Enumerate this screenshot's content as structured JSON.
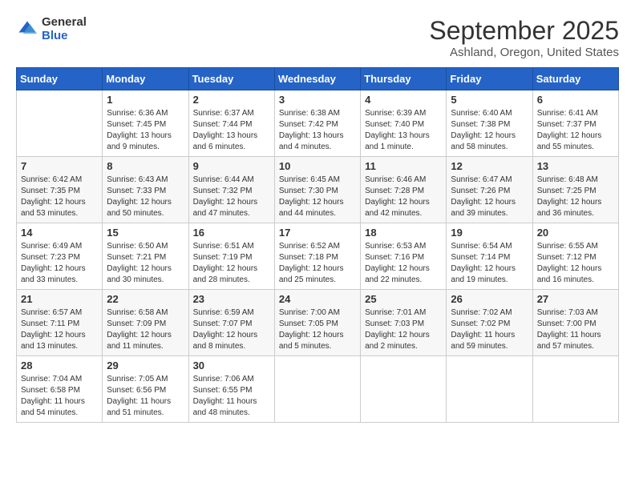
{
  "header": {
    "logo_general": "General",
    "logo_blue": "Blue",
    "month_title": "September 2025",
    "location": "Ashland, Oregon, United States"
  },
  "days_of_week": [
    "Sunday",
    "Monday",
    "Tuesday",
    "Wednesday",
    "Thursday",
    "Friday",
    "Saturday"
  ],
  "weeks": [
    [
      {
        "day": "",
        "info": ""
      },
      {
        "day": "1",
        "info": "Sunrise: 6:36 AM\nSunset: 7:45 PM\nDaylight: 13 hours\nand 9 minutes."
      },
      {
        "day": "2",
        "info": "Sunrise: 6:37 AM\nSunset: 7:44 PM\nDaylight: 13 hours\nand 6 minutes."
      },
      {
        "day": "3",
        "info": "Sunrise: 6:38 AM\nSunset: 7:42 PM\nDaylight: 13 hours\nand 4 minutes."
      },
      {
        "day": "4",
        "info": "Sunrise: 6:39 AM\nSunset: 7:40 PM\nDaylight: 13 hours\nand 1 minute."
      },
      {
        "day": "5",
        "info": "Sunrise: 6:40 AM\nSunset: 7:38 PM\nDaylight: 12 hours\nand 58 minutes."
      },
      {
        "day": "6",
        "info": "Sunrise: 6:41 AM\nSunset: 7:37 PM\nDaylight: 12 hours\nand 55 minutes."
      }
    ],
    [
      {
        "day": "7",
        "info": "Sunrise: 6:42 AM\nSunset: 7:35 PM\nDaylight: 12 hours\nand 53 minutes."
      },
      {
        "day": "8",
        "info": "Sunrise: 6:43 AM\nSunset: 7:33 PM\nDaylight: 12 hours\nand 50 minutes."
      },
      {
        "day": "9",
        "info": "Sunrise: 6:44 AM\nSunset: 7:32 PM\nDaylight: 12 hours\nand 47 minutes."
      },
      {
        "day": "10",
        "info": "Sunrise: 6:45 AM\nSunset: 7:30 PM\nDaylight: 12 hours\nand 44 minutes."
      },
      {
        "day": "11",
        "info": "Sunrise: 6:46 AM\nSunset: 7:28 PM\nDaylight: 12 hours\nand 42 minutes."
      },
      {
        "day": "12",
        "info": "Sunrise: 6:47 AM\nSunset: 7:26 PM\nDaylight: 12 hours\nand 39 minutes."
      },
      {
        "day": "13",
        "info": "Sunrise: 6:48 AM\nSunset: 7:25 PM\nDaylight: 12 hours\nand 36 minutes."
      }
    ],
    [
      {
        "day": "14",
        "info": "Sunrise: 6:49 AM\nSunset: 7:23 PM\nDaylight: 12 hours\nand 33 minutes."
      },
      {
        "day": "15",
        "info": "Sunrise: 6:50 AM\nSunset: 7:21 PM\nDaylight: 12 hours\nand 30 minutes."
      },
      {
        "day": "16",
        "info": "Sunrise: 6:51 AM\nSunset: 7:19 PM\nDaylight: 12 hours\nand 28 minutes."
      },
      {
        "day": "17",
        "info": "Sunrise: 6:52 AM\nSunset: 7:18 PM\nDaylight: 12 hours\nand 25 minutes."
      },
      {
        "day": "18",
        "info": "Sunrise: 6:53 AM\nSunset: 7:16 PM\nDaylight: 12 hours\nand 22 minutes."
      },
      {
        "day": "19",
        "info": "Sunrise: 6:54 AM\nSunset: 7:14 PM\nDaylight: 12 hours\nand 19 minutes."
      },
      {
        "day": "20",
        "info": "Sunrise: 6:55 AM\nSunset: 7:12 PM\nDaylight: 12 hours\nand 16 minutes."
      }
    ],
    [
      {
        "day": "21",
        "info": "Sunrise: 6:57 AM\nSunset: 7:11 PM\nDaylight: 12 hours\nand 13 minutes."
      },
      {
        "day": "22",
        "info": "Sunrise: 6:58 AM\nSunset: 7:09 PM\nDaylight: 12 hours\nand 11 minutes."
      },
      {
        "day": "23",
        "info": "Sunrise: 6:59 AM\nSunset: 7:07 PM\nDaylight: 12 hours\nand 8 minutes."
      },
      {
        "day": "24",
        "info": "Sunrise: 7:00 AM\nSunset: 7:05 PM\nDaylight: 12 hours\nand 5 minutes."
      },
      {
        "day": "25",
        "info": "Sunrise: 7:01 AM\nSunset: 7:03 PM\nDaylight: 12 hours\nand 2 minutes."
      },
      {
        "day": "26",
        "info": "Sunrise: 7:02 AM\nSunset: 7:02 PM\nDaylight: 11 hours\nand 59 minutes."
      },
      {
        "day": "27",
        "info": "Sunrise: 7:03 AM\nSunset: 7:00 PM\nDaylight: 11 hours\nand 57 minutes."
      }
    ],
    [
      {
        "day": "28",
        "info": "Sunrise: 7:04 AM\nSunset: 6:58 PM\nDaylight: 11 hours\nand 54 minutes."
      },
      {
        "day": "29",
        "info": "Sunrise: 7:05 AM\nSunset: 6:56 PM\nDaylight: 11 hours\nand 51 minutes."
      },
      {
        "day": "30",
        "info": "Sunrise: 7:06 AM\nSunset: 6:55 PM\nDaylight: 11 hours\nand 48 minutes."
      },
      {
        "day": "",
        "info": ""
      },
      {
        "day": "",
        "info": ""
      },
      {
        "day": "",
        "info": ""
      },
      {
        "day": "",
        "info": ""
      }
    ]
  ]
}
